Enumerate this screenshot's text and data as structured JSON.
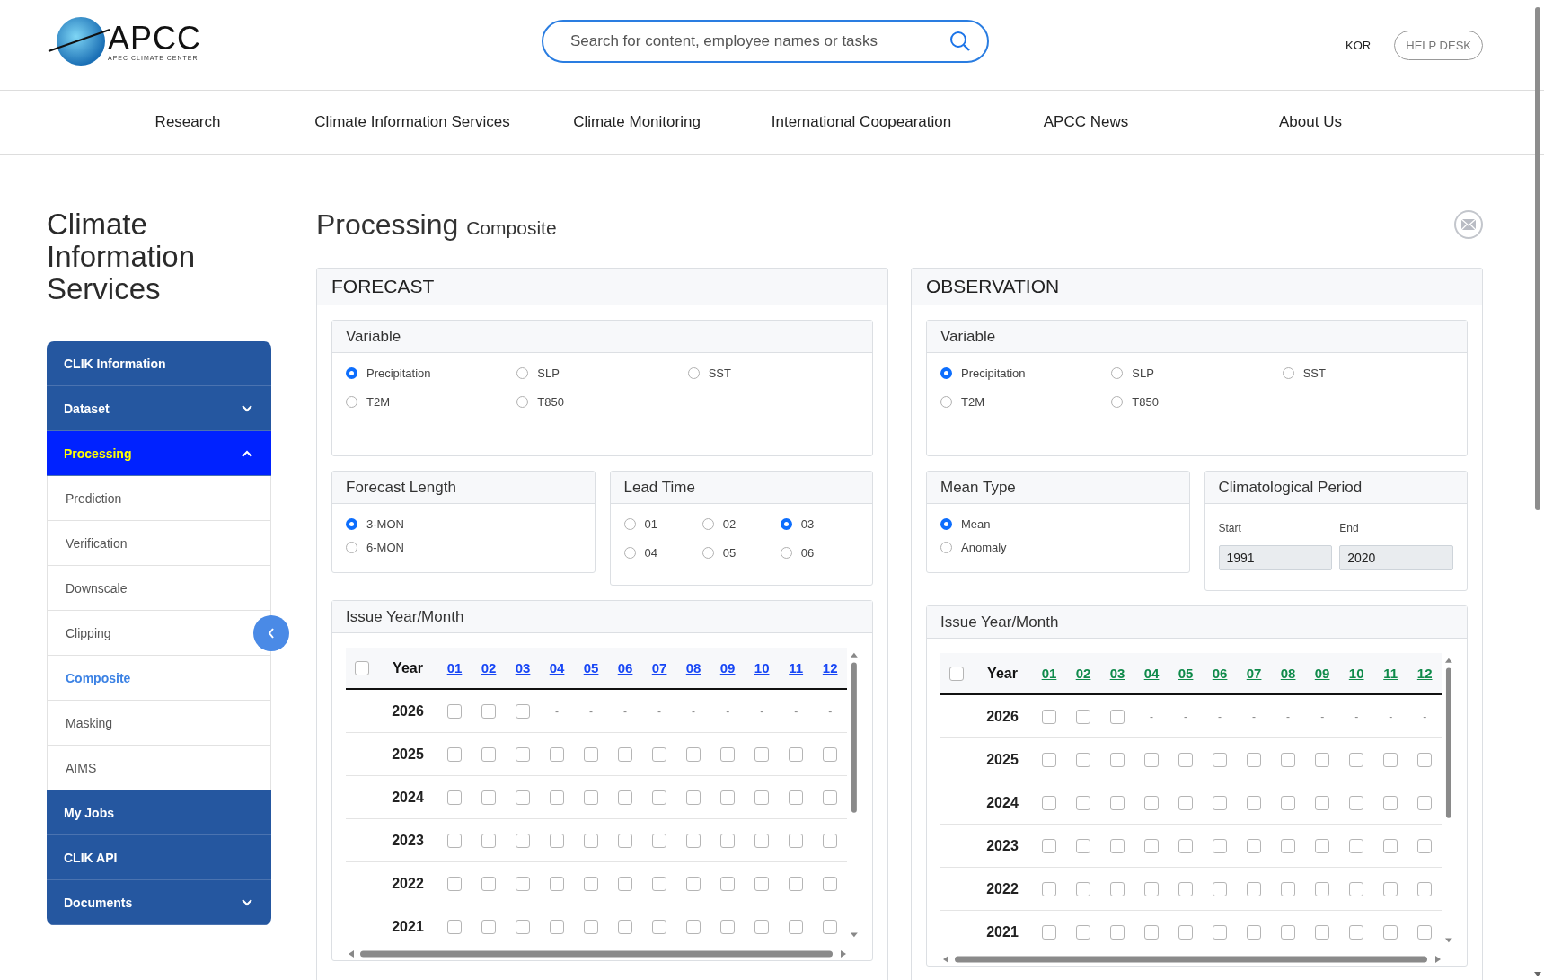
{
  "header": {
    "logo": {
      "name": "APCC",
      "tagline": "APEC CLIMATE CENTER"
    },
    "search": {
      "placeholder": "Search for content, employee names or tasks"
    },
    "language": "KOR",
    "help_desk": "HELP DESK"
  },
  "nav": [
    "Research",
    "Climate Information Services",
    "Climate Monitoring",
    "International Coopearation",
    "APCC News",
    "About Us"
  ],
  "sidebar": {
    "title": "Climate Information Services",
    "items": [
      {
        "kind": "link",
        "label": "CLIK Information",
        "selected": false
      },
      {
        "kind": "folder",
        "label": "Dataset",
        "selected": false,
        "expanded": false
      },
      {
        "kind": "folder",
        "label": "Processing",
        "selected": true,
        "expanded": true,
        "children": [
          {
            "label": "Prediction",
            "selected": false
          },
          {
            "label": "Verification",
            "selected": false
          },
          {
            "label": "Downscale",
            "selected": false
          },
          {
            "label": "Clipping",
            "selected": false
          },
          {
            "label": "Composite",
            "selected": true
          },
          {
            "label": "Masking",
            "selected": false
          },
          {
            "label": "AIMS",
            "selected": false
          }
        ]
      },
      {
        "kind": "link",
        "label": "My Jobs",
        "selected": false
      },
      {
        "kind": "link",
        "label": "CLIK API",
        "selected": false
      },
      {
        "kind": "folder",
        "label": "Documents",
        "selected": false,
        "expanded": false
      }
    ]
  },
  "page": {
    "title": "Processing",
    "subtitle": "Composite"
  },
  "panels": [
    {
      "title": "FORECAST",
      "color": "#1746f5",
      "variable": {
        "title": "Variable",
        "options": [
          {
            "label": "Precipitation",
            "selected": true
          },
          {
            "label": "SLP",
            "selected": false
          },
          {
            "label": "SST",
            "selected": false
          },
          {
            "label": "T2M",
            "selected": false
          },
          {
            "label": "T850",
            "selected": false
          }
        ]
      },
      "pair": [
        {
          "kind": "radio-list",
          "title": "Forecast Length",
          "options": [
            {
              "label": "3-MON",
              "selected": true
            },
            {
              "label": "6-MON",
              "selected": false
            }
          ]
        },
        {
          "kind": "radio-grid",
          "title": "Lead Time",
          "options": [
            {
              "label": "01",
              "selected": false
            },
            {
              "label": "02",
              "selected": false
            },
            {
              "label": "03",
              "selected": true
            },
            {
              "label": "04",
              "selected": false
            },
            {
              "label": "05",
              "selected": false
            },
            {
              "label": "06",
              "selected": false
            }
          ]
        }
      ],
      "issue": {
        "title": "Issue Year/Month",
        "all_checked": false,
        "year_heading": "Year",
        "months": [
          "01",
          "02",
          "03",
          "04",
          "05",
          "06",
          "07",
          "08",
          "09",
          "10",
          "11",
          "12"
        ],
        "rows": [
          {
            "year": "2026",
            "cells": [
              {
                "kind": "check",
                "checked": false
              },
              {
                "kind": "check",
                "checked": false
              },
              {
                "kind": "check",
                "checked": false
              },
              {
                "kind": "dash",
                "text": "-"
              },
              {
                "kind": "dash",
                "text": "-"
              },
              {
                "kind": "dash",
                "text": "-"
              },
              {
                "kind": "dash",
                "text": "-"
              },
              {
                "kind": "dash",
                "text": "-"
              },
              {
                "kind": "dash",
                "text": "-"
              },
              {
                "kind": "dash",
                "text": "-"
              },
              {
                "kind": "dash",
                "text": "-"
              },
              {
                "kind": "dash",
                "text": "-"
              }
            ]
          },
          {
            "year": "2025",
            "cells": [
              {
                "kind": "check",
                "checked": false
              },
              {
                "kind": "check",
                "checked": false
              },
              {
                "kind": "check",
                "checked": false
              },
              {
                "kind": "check",
                "checked": false
              },
              {
                "kind": "check",
                "checked": false
              },
              {
                "kind": "check",
                "checked": false
              },
              {
                "kind": "check",
                "checked": false
              },
              {
                "kind": "check",
                "checked": false
              },
              {
                "kind": "check",
                "checked": false
              },
              {
                "kind": "check",
                "checked": false
              },
              {
                "kind": "check",
                "checked": false
              },
              {
                "kind": "check",
                "checked": false
              }
            ]
          },
          {
            "year": "2024",
            "cells": [
              {
                "kind": "check",
                "checked": false
              },
              {
                "kind": "check",
                "checked": false
              },
              {
                "kind": "check",
                "checked": false
              },
              {
                "kind": "check",
                "checked": false
              },
              {
                "kind": "check",
                "checked": false
              },
              {
                "kind": "check",
                "checked": false
              },
              {
                "kind": "check",
                "checked": false
              },
              {
                "kind": "check",
                "checked": false
              },
              {
                "kind": "check",
                "checked": false
              },
              {
                "kind": "check",
                "checked": false
              },
              {
                "kind": "check",
                "checked": false
              },
              {
                "kind": "check",
                "checked": false
              }
            ]
          },
          {
            "year": "2023",
            "cells": [
              {
                "kind": "check",
                "checked": false
              },
              {
                "kind": "check",
                "checked": false
              },
              {
                "kind": "check",
                "checked": false
              },
              {
                "kind": "check",
                "checked": false
              },
              {
                "kind": "check",
                "checked": false
              },
              {
                "kind": "check",
                "checked": false
              },
              {
                "kind": "check",
                "checked": false
              },
              {
                "kind": "check",
                "checked": false
              },
              {
                "kind": "check",
                "checked": false
              },
              {
                "kind": "check",
                "checked": false
              },
              {
                "kind": "check",
                "checked": false
              },
              {
                "kind": "check",
                "checked": false
              }
            ]
          },
          {
            "year": "2022",
            "cells": [
              {
                "kind": "check",
                "checked": false
              },
              {
                "kind": "check",
                "checked": false
              },
              {
                "kind": "check",
                "checked": false
              },
              {
                "kind": "check",
                "checked": false
              },
              {
                "kind": "check",
                "checked": false
              },
              {
                "kind": "check",
                "checked": false
              },
              {
                "kind": "check",
                "checked": false
              },
              {
                "kind": "check",
                "checked": false
              },
              {
                "kind": "check",
                "checked": false
              },
              {
                "kind": "check",
                "checked": false
              },
              {
                "kind": "check",
                "checked": false
              },
              {
                "kind": "check",
                "checked": false
              }
            ]
          },
          {
            "year": "2021",
            "cells": [
              {
                "kind": "check",
                "checked": false
              },
              {
                "kind": "check",
                "checked": false
              },
              {
                "kind": "check",
                "checked": false
              },
              {
                "kind": "check",
                "checked": false
              },
              {
                "kind": "check",
                "checked": false
              },
              {
                "kind": "check",
                "checked": false
              },
              {
                "kind": "check",
                "checked": false
              },
              {
                "kind": "check",
                "checked": false
              },
              {
                "kind": "check",
                "checked": false
              },
              {
                "kind": "check",
                "checked": false
              },
              {
                "kind": "check",
                "checked": false
              },
              {
                "kind": "check",
                "checked": false
              }
            ]
          }
        ]
      }
    },
    {
      "title": "OBSERVATION",
      "color": "#0f8a4a",
      "variable": {
        "title": "Variable",
        "options": [
          {
            "label": "Precipitation",
            "selected": true
          },
          {
            "label": "SLP",
            "selected": false
          },
          {
            "label": "SST",
            "selected": false
          },
          {
            "label": "T2M",
            "selected": false
          },
          {
            "label": "T850",
            "selected": false
          }
        ]
      },
      "pair": [
        {
          "kind": "radio-list",
          "title": "Mean Type",
          "options": [
            {
              "label": "Mean",
              "selected": true
            },
            {
              "label": "Anomaly",
              "selected": false
            }
          ]
        },
        {
          "kind": "period",
          "title": "Climatological Period",
          "start": {
            "label": "Start",
            "value": "1991"
          },
          "end": {
            "label": "End",
            "value": "2020"
          }
        }
      ],
      "issue": {
        "title": "Issue Year/Month",
        "all_checked": false,
        "year_heading": "Year",
        "months": [
          "01",
          "02",
          "03",
          "04",
          "05",
          "06",
          "07",
          "08",
          "09",
          "10",
          "11",
          "12"
        ],
        "rows": [
          {
            "year": "2026",
            "cells": [
              {
                "kind": "check",
                "checked": false
              },
              {
                "kind": "check",
                "checked": false
              },
              {
                "kind": "check",
                "checked": false
              },
              {
                "kind": "dash",
                "text": "-"
              },
              {
                "kind": "dash",
                "text": "-"
              },
              {
                "kind": "dash",
                "text": "-"
              },
              {
                "kind": "dash",
                "text": "-"
              },
              {
                "kind": "dash",
                "text": "-"
              },
              {
                "kind": "dash",
                "text": "-"
              },
              {
                "kind": "dash",
                "text": "-"
              },
              {
                "kind": "dash",
                "text": "-"
              },
              {
                "kind": "dash",
                "text": "-"
              }
            ]
          },
          {
            "year": "2025",
            "cells": [
              {
                "kind": "check",
                "checked": false
              },
              {
                "kind": "check",
                "checked": false
              },
              {
                "kind": "check",
                "checked": false
              },
              {
                "kind": "check",
                "checked": false
              },
              {
                "kind": "check",
                "checked": false
              },
              {
                "kind": "check",
                "checked": false
              },
              {
                "kind": "check",
                "checked": false
              },
              {
                "kind": "check",
                "checked": false
              },
              {
                "kind": "check",
                "checked": false
              },
              {
                "kind": "check",
                "checked": false
              },
              {
                "kind": "check",
                "checked": false
              },
              {
                "kind": "check",
                "checked": false
              }
            ]
          },
          {
            "year": "2024",
            "cells": [
              {
                "kind": "check",
                "checked": false
              },
              {
                "kind": "check",
                "checked": false
              },
              {
                "kind": "check",
                "checked": false
              },
              {
                "kind": "check",
                "checked": false
              },
              {
                "kind": "check",
                "checked": false
              },
              {
                "kind": "check",
                "checked": false
              },
              {
                "kind": "check",
                "checked": false
              },
              {
                "kind": "check",
                "checked": false
              },
              {
                "kind": "check",
                "checked": false
              },
              {
                "kind": "check",
                "checked": false
              },
              {
                "kind": "check",
                "checked": false
              },
              {
                "kind": "check",
                "checked": false
              }
            ]
          },
          {
            "year": "2023",
            "cells": [
              {
                "kind": "check",
                "checked": false
              },
              {
                "kind": "check",
                "checked": false
              },
              {
                "kind": "check",
                "checked": false
              },
              {
                "kind": "check",
                "checked": false
              },
              {
                "kind": "check",
                "checked": false
              },
              {
                "kind": "check",
                "checked": false
              },
              {
                "kind": "check",
                "checked": false
              },
              {
                "kind": "check",
                "checked": false
              },
              {
                "kind": "check",
                "checked": false
              },
              {
                "kind": "check",
                "checked": false
              },
              {
                "kind": "check",
                "checked": false
              },
              {
                "kind": "check",
                "checked": false
              }
            ]
          },
          {
            "year": "2022",
            "cells": [
              {
                "kind": "check",
                "checked": false
              },
              {
                "kind": "check",
                "checked": false
              },
              {
                "kind": "check",
                "checked": false
              },
              {
                "kind": "check",
                "checked": false
              },
              {
                "kind": "check",
                "checked": false
              },
              {
                "kind": "check",
                "checked": false
              },
              {
                "kind": "check",
                "checked": false
              },
              {
                "kind": "check",
                "checked": false
              },
              {
                "kind": "check",
                "checked": false
              },
              {
                "kind": "check",
                "checked": false
              },
              {
                "kind": "check",
                "checked": false
              },
              {
                "kind": "check",
                "checked": false
              }
            ]
          },
          {
            "year": "2021",
            "cells": [
              {
                "kind": "check",
                "checked": false
              },
              {
                "kind": "check",
                "checked": false
              },
              {
                "kind": "check",
                "checked": false
              },
              {
                "kind": "check",
                "checked": false
              },
              {
                "kind": "check",
                "checked": false
              },
              {
                "kind": "check",
                "checked": false
              },
              {
                "kind": "check",
                "checked": false
              },
              {
                "kind": "check",
                "checked": false
              },
              {
                "kind": "check",
                "checked": false
              },
              {
                "kind": "check",
                "checked": false
              },
              {
                "kind": "check",
                "checked": false
              },
              {
                "kind": "check",
                "checked": false
              }
            ]
          }
        ]
      }
    }
  ]
}
